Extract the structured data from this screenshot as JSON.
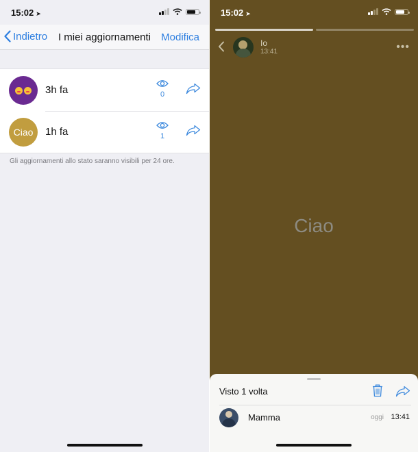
{
  "colors": {
    "accent": "#2c7ee0",
    "story_background": "#644f21",
    "list_background": "#efeff4"
  },
  "left_screen": {
    "status_bar": {
      "time": "15:02"
    },
    "nav": {
      "back_label": "Indietro",
      "title": "I miei aggiornamenti",
      "edit_label": "Modifica"
    },
    "updates": [
      {
        "avatar_icon": "double-emoji-icon",
        "time": "3h fa",
        "view_count": "0"
      },
      {
        "avatar_text": "Ciao",
        "time": "1h fa",
        "view_count": "1"
      }
    ],
    "note": "Gli aggiornamenti allo stato saranno visibili per 24 ore."
  },
  "right_screen": {
    "status_bar": {
      "time": "15:02"
    },
    "story": {
      "author": "Io",
      "time": "13:41",
      "text": "Ciao",
      "segments_total": 2,
      "segments_done": 1
    },
    "viewers_sheet": {
      "title": "Visto 1 volta",
      "viewers": [
        {
          "name": "Mamma",
          "day": "oggi",
          "time": "13:41"
        }
      ]
    }
  }
}
